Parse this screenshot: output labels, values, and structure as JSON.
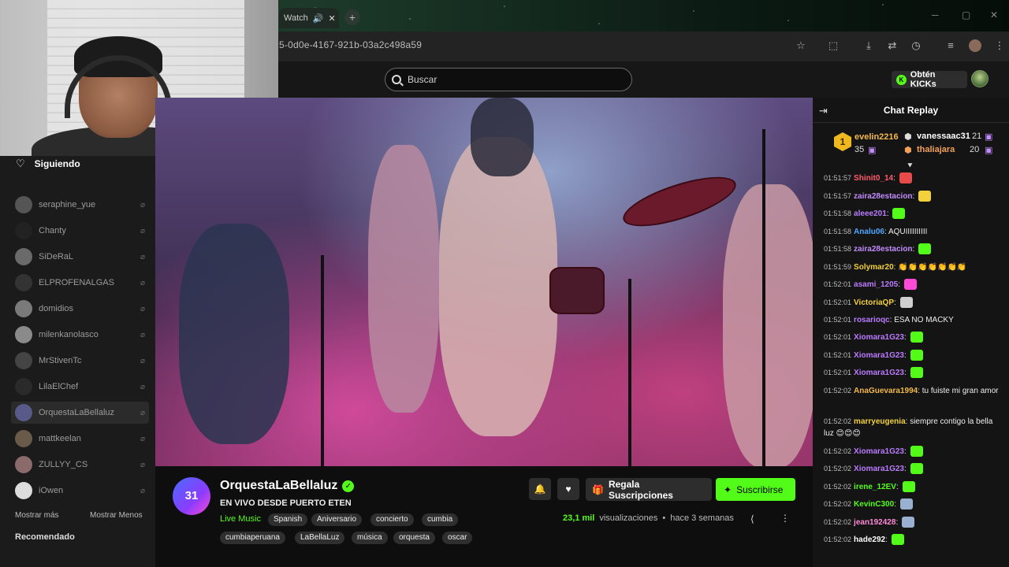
{
  "browser": {
    "tab_label": "Watch",
    "url": "5-0d0e-4167-921b-03a2c498a59"
  },
  "header": {
    "search_placeholder": "Buscar",
    "kicks_label": "Obtén KICKs"
  },
  "sidebar": {
    "following_label": "Siguiendo",
    "items": [
      {
        "name": "seraphine_yue"
      },
      {
        "name": "Chanty"
      },
      {
        "name": "SiDeRaL"
      },
      {
        "name": "ELPROFENALGAS"
      },
      {
        "name": "domidios"
      },
      {
        "name": "milenkanolasco"
      },
      {
        "name": "MrStivenTc"
      },
      {
        "name": "LilaElChef"
      },
      {
        "name": "OrquestaLaBellaluz"
      },
      {
        "name": "mattkeelan"
      },
      {
        "name": "ZULLYY_CS"
      },
      {
        "name": "iOwen"
      }
    ],
    "show_more": "Mostrar más",
    "show_less": "Mostrar Menos",
    "recommended": "Recomendado"
  },
  "channel": {
    "avatar_text": "31",
    "name": "OrquestaLaBellaluz",
    "title": "EN VIVO DESDE PUERTO ETEN",
    "category": "Live Music",
    "tags": [
      "Spanish",
      "Aniversario",
      "concierto",
      "cumbia",
      "cumbiaperuana",
      "LaBellaLuz",
      "música",
      "orquesta",
      "oscar"
    ],
    "gift_label": "Regala Suscripciones",
    "subscribe_label": "Suscribirse",
    "views_count": "23,1 mil",
    "views_label": "visualizaciones",
    "ago": "hace 3 semanas",
    "separator": "•"
  },
  "chat": {
    "title": "Chat Replay",
    "leaderboard": {
      "rank": "1",
      "first": {
        "name": "evelin2216",
        "count": "35"
      },
      "second": {
        "name": "vanessaac31",
        "count": "21"
      },
      "third": {
        "name": "thaliajara",
        "count": "20"
      }
    },
    "messages": [
      {
        "time": "01:51:57",
        "user": "Shinit0_14",
        "text": "",
        "color": "#ff5b6b",
        "emote": "#e84a4a"
      },
      {
        "time": "01:51:57",
        "user": "zaira28estacion",
        "text": "",
        "color": "#c48bff",
        "emote": "#f2d13a"
      },
      {
        "time": "01:51:58",
        "user": "aleee201",
        "text": "",
        "color": "#ba7bff",
        "emote": "#53fc18"
      },
      {
        "time": "01:51:58",
        "user": "Analu06",
        "text": "AQUIIIIIIIIII",
        "color": "#4fa8ff",
        "emote": ""
      },
      {
        "time": "01:51:58",
        "user": "zaira28estacion",
        "text": "",
        "color": "#c48bff",
        "emote": "#53fc18"
      },
      {
        "time": "01:51:59",
        "user": "Solymar20",
        "text": "👏👏👏👏👏👏👏",
        "color": "#f2d13a",
        "emote": ""
      },
      {
        "time": "01:52:01",
        "user": "asami_1205",
        "text": "",
        "color": "#ba7bff",
        "emote": "#ff4ad8"
      },
      {
        "time": "01:52:01",
        "user": "VictoriaQP",
        "text": "",
        "color": "#f2d13a",
        "emote": "#cfcfcf"
      },
      {
        "time": "01:52:01",
        "user": "rosarioqc",
        "text": "ESA NO MACKY",
        "color": "#ba7bff",
        "emote": ""
      },
      {
        "time": "01:52:01",
        "user": "Xiomara1G23",
        "text": "",
        "color": "#ba7bff",
        "emote": "#53fc18"
      },
      {
        "time": "01:52:01",
        "user": "Xiomara1G23",
        "text": "",
        "color": "#ba7bff",
        "emote": "#53fc18"
      },
      {
        "time": "01:52:01",
        "user": "Xiomara1G23",
        "text": "",
        "color": "#ba7bff",
        "emote": "#53fc18"
      },
      {
        "time": "01:52:02",
        "user": "AnaGuevara1994",
        "text": "tu fuiste mi gran amor",
        "color": "#f2b84a",
        "emote": ""
      },
      {
        "time": "01:52:02",
        "user": "marryeugenia",
        "text": "siempre contigo la bella luz 😊😊😊",
        "color": "#f2d13a",
        "emote": ""
      },
      {
        "time": "01:52:02",
        "user": "Xiomara1G23",
        "text": "",
        "color": "#ba7bff",
        "emote": "#53fc18"
      },
      {
        "time": "01:52:02",
        "user": "Xiomara1G23",
        "text": "",
        "color": "#ba7bff",
        "emote": "#53fc18"
      },
      {
        "time": "01:52:02",
        "user": "irene_12EV",
        "text": "",
        "color": "#53fc18",
        "emote": "#53fc18"
      },
      {
        "time": "01:52:02",
        "user": "KevinC300",
        "text": "",
        "color": "#53fc18",
        "emote": "#9ab0d0"
      },
      {
        "time": "01:52:02",
        "user": "jean192428",
        "text": "",
        "color": "#ff8ad8",
        "emote": "#9ab0d0"
      },
      {
        "time": "01:52:02",
        "user": "hade292",
        "text": "",
        "color": "#ffffff",
        "emote": "#53fc18"
      }
    ]
  },
  "colors": {
    "accent": "#53fc18",
    "panel": "#1b1b1b",
    "chat_bg": "#141414"
  }
}
